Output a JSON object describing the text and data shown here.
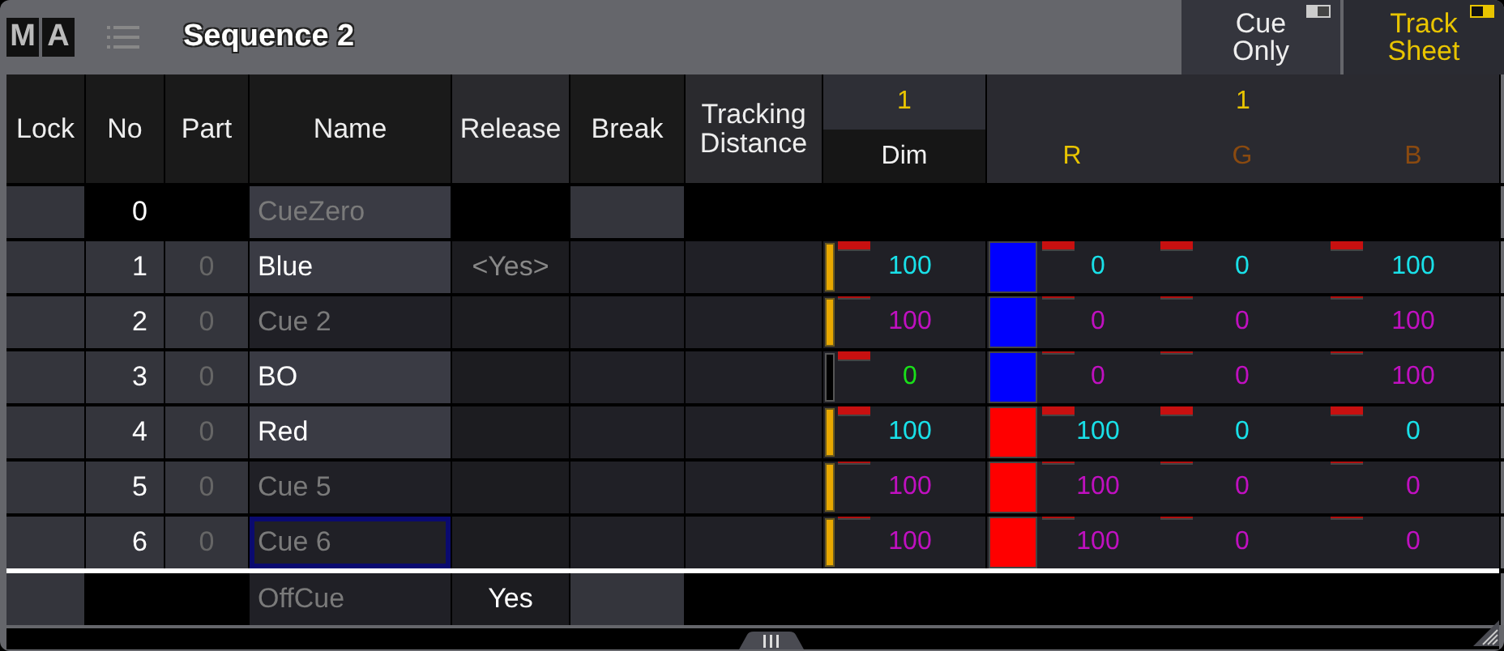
{
  "window": {
    "logo": [
      "M",
      "A"
    ],
    "title": "Sequence 2"
  },
  "tabs": [
    {
      "label": "Cue Only",
      "on": false,
      "selected": false
    },
    {
      "label": "Track Sheet",
      "on": true,
      "selected": true
    }
  ],
  "columns": [
    "Lock",
    "No",
    "Part",
    "Name",
    "Release",
    "Break",
    "Tracking Distance"
  ],
  "groups": [
    {
      "number": "1",
      "channels": [
        {
          "label": "Dim",
          "color": "#f0f0f0"
        }
      ]
    },
    {
      "number": "1",
      "channels": [
        {
          "label": "R",
          "color": "#e8c400"
        },
        {
          "label": "G",
          "color": "#8a4a10"
        },
        {
          "label": "B",
          "color": "#8a4a10"
        }
      ]
    }
  ],
  "rows": [
    {
      "kind": "zero",
      "no": "0",
      "name": "CueZero"
    },
    {
      "kind": "cue",
      "no": "1",
      "part": "0",
      "name": "Blue",
      "generic_name": false,
      "focused": false,
      "release": "<Yes>",
      "dim": {
        "active": true,
        "value": "100",
        "color": "#19e0e8",
        "changed": true
      },
      "color": "#0000ff",
      "rgb": [
        {
          "value": "0",
          "color": "#19e0e8",
          "changed": true
        },
        {
          "value": "0",
          "color": "#19e0e8",
          "changed": true
        },
        {
          "value": "100",
          "color": "#19e0e8",
          "changed": true
        }
      ]
    },
    {
      "kind": "cue",
      "no": "2",
      "part": "0",
      "name": "Cue  2",
      "generic_name": true,
      "focused": false,
      "dim": {
        "active": true,
        "value": "100",
        "color": "#c010c0",
        "changed": false
      },
      "color": "#0000ff",
      "rgb": [
        {
          "value": "0",
          "color": "#c010c0",
          "changed": false
        },
        {
          "value": "0",
          "color": "#c010c0",
          "changed": false
        },
        {
          "value": "100",
          "color": "#c010c0",
          "changed": false
        }
      ]
    },
    {
      "kind": "cue",
      "no": "3",
      "part": "0",
      "name": "BO",
      "generic_name": false,
      "focused": false,
      "dim": {
        "active": false,
        "value": "0",
        "color": "#19e019",
        "changed": true
      },
      "color": "#0000ff",
      "rgb": [
        {
          "value": "0",
          "color": "#c010c0",
          "changed": false
        },
        {
          "value": "0",
          "color": "#c010c0",
          "changed": false
        },
        {
          "value": "100",
          "color": "#c010c0",
          "changed": false
        }
      ]
    },
    {
      "kind": "cue",
      "no": "4",
      "part": "0",
      "name": "Red",
      "generic_name": false,
      "focused": false,
      "dim": {
        "active": true,
        "value": "100",
        "color": "#19e0e8",
        "changed": true
      },
      "color": "#ff0000",
      "rgb": [
        {
          "value": "100",
          "color": "#19e0e8",
          "changed": true
        },
        {
          "value": "0",
          "color": "#19e0e8",
          "changed": true
        },
        {
          "value": "0",
          "color": "#19e0e8",
          "changed": true
        }
      ]
    },
    {
      "kind": "cue",
      "no": "5",
      "part": "0",
      "name": "Cue  5",
      "generic_name": true,
      "focused": false,
      "dim": {
        "active": true,
        "value": "100",
        "color": "#c010c0",
        "changed": false
      },
      "color": "#ff0000",
      "rgb": [
        {
          "value": "100",
          "color": "#c010c0",
          "changed": false
        },
        {
          "value": "0",
          "color": "#c010c0",
          "changed": false
        },
        {
          "value": "0",
          "color": "#c010c0",
          "changed": false
        }
      ]
    },
    {
      "kind": "cue",
      "no": "6",
      "part": "0",
      "name": "Cue  6",
      "generic_name": true,
      "focused": true,
      "dim": {
        "active": true,
        "value": "100",
        "color": "#c010c0",
        "changed": false
      },
      "color": "#ff0000",
      "rgb": [
        {
          "value": "100",
          "color": "#c010c0",
          "changed": false
        },
        {
          "value": "0",
          "color": "#c010c0",
          "changed": false
        },
        {
          "value": "0",
          "color": "#c010c0",
          "changed": false
        }
      ]
    },
    {
      "kind": "off",
      "name": "OffCue",
      "release": "Yes"
    }
  ]
}
